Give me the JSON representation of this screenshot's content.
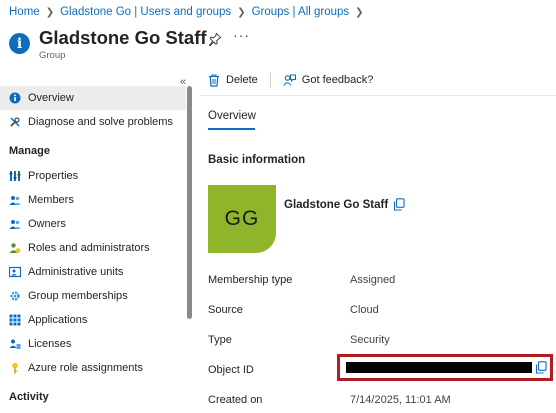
{
  "breadcrumb": [
    {
      "label": "Home"
    },
    {
      "label": "Gladstone Go | Users and groups"
    },
    {
      "label": "Groups | All groups"
    }
  ],
  "header": {
    "title": "Gladstone Go Staff",
    "subtitle": "Group",
    "more": "···"
  },
  "sidebar": {
    "collapse_glyph": "«",
    "items_top": [
      {
        "label": "Overview",
        "icon": "info-icon",
        "active": true
      },
      {
        "label": "Diagnose and solve problems",
        "icon": "wrench-icon"
      }
    ],
    "section_manage": "Manage",
    "items_manage": [
      {
        "label": "Properties",
        "icon": "properties-icon"
      },
      {
        "label": "Members",
        "icon": "members-icon"
      },
      {
        "label": "Owners",
        "icon": "owners-icon"
      },
      {
        "label": "Roles and administrators",
        "icon": "roles-icon"
      },
      {
        "label": "Administrative units",
        "icon": "admin-units-icon"
      },
      {
        "label": "Group memberships",
        "icon": "gear-icon"
      },
      {
        "label": "Applications",
        "icon": "grid-icon"
      },
      {
        "label": "Licenses",
        "icon": "license-icon"
      },
      {
        "label": "Azure role assignments",
        "icon": "key-icon"
      }
    ],
    "section_activity": "Activity"
  },
  "toolbar": {
    "delete_label": "Delete",
    "feedback_label": "Got feedback?"
  },
  "tabs": {
    "overview": "Overview"
  },
  "basic_info": {
    "title": "Basic information",
    "avatar_initials": "GG",
    "display_name": "Gladstone Go Staff",
    "properties": [
      {
        "label": "Membership type",
        "value": "Assigned"
      },
      {
        "label": "Source",
        "value": "Cloud"
      },
      {
        "label": "Type",
        "value": "Security"
      },
      {
        "label": "Object ID",
        "value": ""
      },
      {
        "label": "Created on",
        "value": "7/14/2025, 11:01 AM"
      }
    ]
  },
  "colors": {
    "accent": "#0f6cbd",
    "avatar_bg": "#8fb52b",
    "highlight_border": "#b01e23"
  }
}
